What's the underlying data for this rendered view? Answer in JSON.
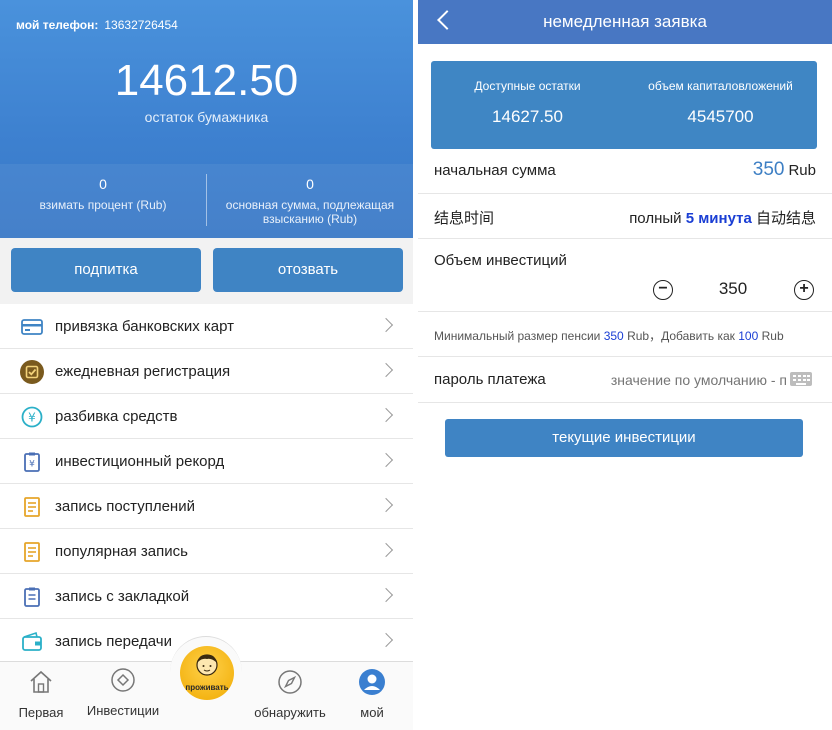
{
  "left": {
    "phone_label": "мой телефон:",
    "phone_number": "13632726454",
    "balance": "14612.50",
    "balance_label": "остаток бумажника",
    "stats": [
      {
        "value": "0",
        "label": "взимать процент (Rub)"
      },
      {
        "value": "0",
        "label": "основная сумма, подлежащая взысканию (Rub)"
      }
    ],
    "buttons": {
      "subscribe": "подпитка",
      "withdraw": "отозвать"
    },
    "menu": [
      {
        "label": "привязка банковских карт",
        "icon": "bank-card-icon"
      },
      {
        "label": "ежедневная регистрация",
        "icon": "checkin-icon"
      },
      {
        "label": "разбивка средств",
        "icon": "yen-icon"
      },
      {
        "label": "инвестиционный рекорд",
        "icon": "clipboard-yen-icon"
      },
      {
        "label": "запись поступлений",
        "icon": "document-icon"
      },
      {
        "label": "популярная запись",
        "icon": "document-icon"
      },
      {
        "label": "запись с закладкой",
        "icon": "clipboard-icon"
      },
      {
        "label": "запись передачи",
        "icon": "wallet-icon"
      }
    ],
    "tabs": [
      {
        "label": "Первая",
        "icon": "home-icon"
      },
      {
        "label": "Инвестиции",
        "icon": "diamond-icon"
      },
      {
        "label": "проживать",
        "icon": "avatar-icon"
      },
      {
        "label": "обнаружить",
        "icon": "compass-icon"
      },
      {
        "label": "мой",
        "icon": "user-icon"
      }
    ]
  },
  "right": {
    "title": "немедленная заявка",
    "available_label": "Доступные остатки",
    "available_value": "14627.50",
    "invest_volume_label": "объем капиталовложений",
    "invest_volume_value": "4545700",
    "start_amount_label": "начальная сумма",
    "start_amount_value": "350",
    "start_amount_unit": "Rub",
    "settle_label": "结息时间",
    "settle_prefix": "полный",
    "settle_highlight": "5 минута",
    "settle_suffix": "自动结息",
    "investment_label": "Объем инвестиций",
    "stepper_minus": "−",
    "stepper_value": "350",
    "stepper_plus": "+",
    "note_prefix": "Минимальный размер пенсии",
    "note_min": "350",
    "note_mid": "Rub，Добавить как",
    "note_step": "100",
    "note_unit": "Rub",
    "password_label": "пароль платежа",
    "password_placeholder": "значение по умолчанию - п",
    "submit_label": "текущие инвестиции"
  },
  "colors": {
    "hero_blue": "#3d80cf",
    "button_blue": "#3f84c4",
    "topbar_blue": "#4877c3",
    "highlight_blue": "#1a3ed4",
    "gold": "#f3b210"
  }
}
